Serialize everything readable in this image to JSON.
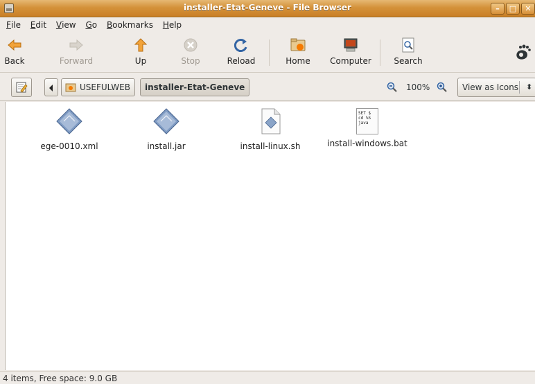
{
  "window": {
    "title": "installer-Etat-Geneve - File Browser"
  },
  "menu": {
    "items": [
      {
        "label": "File",
        "mnemonic": "F",
        "rest": "ile"
      },
      {
        "label": "Edit",
        "mnemonic": "E",
        "rest": "dit"
      },
      {
        "label": "View",
        "mnemonic": "V",
        "rest": "iew"
      },
      {
        "label": "Go",
        "mnemonic": "G",
        "rest": "o"
      },
      {
        "label": "Bookmarks",
        "mnemonic": "B",
        "rest": "ookmarks"
      },
      {
        "label": "Help",
        "mnemonic": "H",
        "rest": "elp"
      }
    ]
  },
  "toolbar": {
    "back": "Back",
    "forward": "Forward",
    "up": "Up",
    "stop": "Stop",
    "reload": "Reload",
    "home": "Home",
    "computer": "Computer",
    "search": "Search"
  },
  "location": {
    "path": [
      "USEFULWEB",
      "installer-Etat-Geneve"
    ],
    "zoom": "100%",
    "view_mode": "View as Icons"
  },
  "files": [
    {
      "name": "ege-0010.xml",
      "icon": "xml-file-icon"
    },
    {
      "name": "install.jar",
      "icon": "jar-file-icon"
    },
    {
      "name": "install-linux.sh",
      "icon": "shell-script-icon"
    },
    {
      "name": "install-windows.bat",
      "icon": "batch-file-icon",
      "preview": [
        "SET $",
        "cd %S",
        "java"
      ]
    }
  ],
  "status": {
    "text": "4 items, Free space: 9.0 GB"
  }
}
